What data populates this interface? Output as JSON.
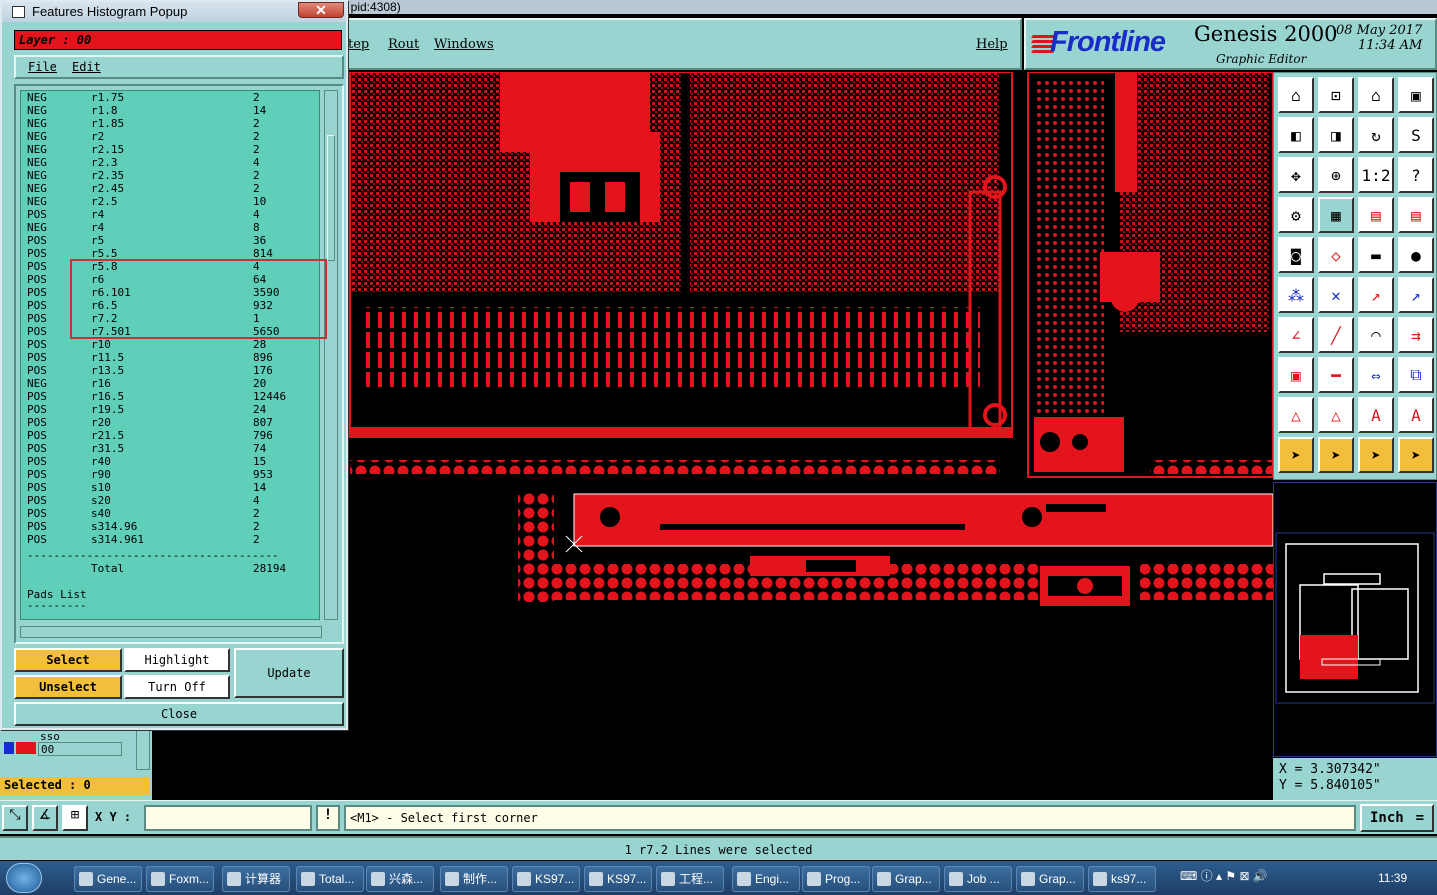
{
  "window": {
    "title_fragment": ", pid:4308)"
  },
  "menubar": {
    "items": [
      "tep",
      "Rout",
      "Windows"
    ],
    "help": "Help"
  },
  "logo": {
    "brand": "Frontline",
    "product": "Genesis 2000",
    "subtitle": "Graphic Editor",
    "date": "08 May 2017",
    "time": "11:34 AM"
  },
  "popup": {
    "title": "Features Histogram Popup",
    "close_glyph": "✕",
    "layer_label": "Layer :  00",
    "menu": {
      "file": "File",
      "edit": "Edit"
    },
    "rows": [
      [
        "NEG",
        "r1.75",
        "2"
      ],
      [
        "NEG",
        "r1.8",
        "14"
      ],
      [
        "NEG",
        "r1.85",
        "2"
      ],
      [
        "NEG",
        "r2",
        "2"
      ],
      [
        "NEG",
        "r2.15",
        "2"
      ],
      [
        "NEG",
        "r2.3",
        "4"
      ],
      [
        "NEG",
        "r2.35",
        "2"
      ],
      [
        "NEG",
        "r2.45",
        "2"
      ],
      [
        "NEG",
        "r2.5",
        "10"
      ],
      [
        "POS",
        "r4",
        "4"
      ],
      [
        "NEG",
        "r4",
        "8"
      ],
      [
        "POS",
        "r5",
        "36"
      ],
      [
        "POS",
        "r5.5",
        "814"
      ],
      [
        "POS",
        "r5.8",
        "4"
      ],
      [
        "POS",
        "r6",
        "64"
      ],
      [
        "POS",
        "r6.101",
        "3590"
      ],
      [
        "POS",
        "r6.5",
        "932"
      ],
      [
        "POS",
        "r7.2",
        "1"
      ],
      [
        "POS",
        "r7.501",
        "5650"
      ],
      [
        "POS",
        "r10",
        "28"
      ],
      [
        "POS",
        "r11.5",
        "896"
      ],
      [
        "POS",
        "r13.5",
        "176"
      ],
      [
        "NEG",
        "r16",
        "20"
      ],
      [
        "POS",
        "r16.5",
        "12446"
      ],
      [
        "POS",
        "r19.5",
        "24"
      ],
      [
        "POS",
        "r20",
        "807"
      ],
      [
        "POS",
        "r21.5",
        "796"
      ],
      [
        "POS",
        "r31.5",
        "74"
      ],
      [
        "POS",
        "r40",
        "15"
      ],
      [
        "POS",
        "r90",
        "953"
      ],
      [
        "POS",
        "s10",
        "14"
      ],
      [
        "POS",
        "s20",
        "4"
      ],
      [
        "POS",
        "s40",
        "2"
      ],
      [
        "POS",
        "s314.96",
        "2"
      ],
      [
        "POS",
        "s314.961",
        "2"
      ]
    ],
    "separator": "--------------------------------------",
    "total_label": "Total",
    "total_value": "28194",
    "pads_label": "Pads List",
    "pads_sep": "---------",
    "buttons": {
      "select": "Select",
      "highlight": "Highlight",
      "update": "Update",
      "unselect": "Unselect",
      "turn_off": "Turn Off",
      "close": "Close"
    }
  },
  "left_panel": {
    "layer_row": "sso",
    "layer_value": "00",
    "selected": "Selected : 0"
  },
  "coords": {
    "x": "X = 3.307342\"",
    "y": "Y = 5.840105\""
  },
  "statusbar": {
    "xy_label": "X Y :",
    "xy_value": "",
    "prompt": "<M1> - Select first corner",
    "units": "Inch"
  },
  "message": "1 r7.2 Lines were selected",
  "taskbar": {
    "items": [
      "Gene...",
      "Foxm...",
      "计算器",
      "Total...",
      "兴森...",
      "制作...",
      "KS97...",
      "KS97...",
      "工程...",
      "Engi...",
      "Prog...",
      "Grap...",
      "Job ...",
      "Grap...",
      "ks97..."
    ],
    "clock": "11:39"
  },
  "colors": {
    "panel": "#99d5d0",
    "accent_red": "#e4141c",
    "button_orange": "#f2bf3c",
    "list_bg": "#5fcfb9"
  }
}
